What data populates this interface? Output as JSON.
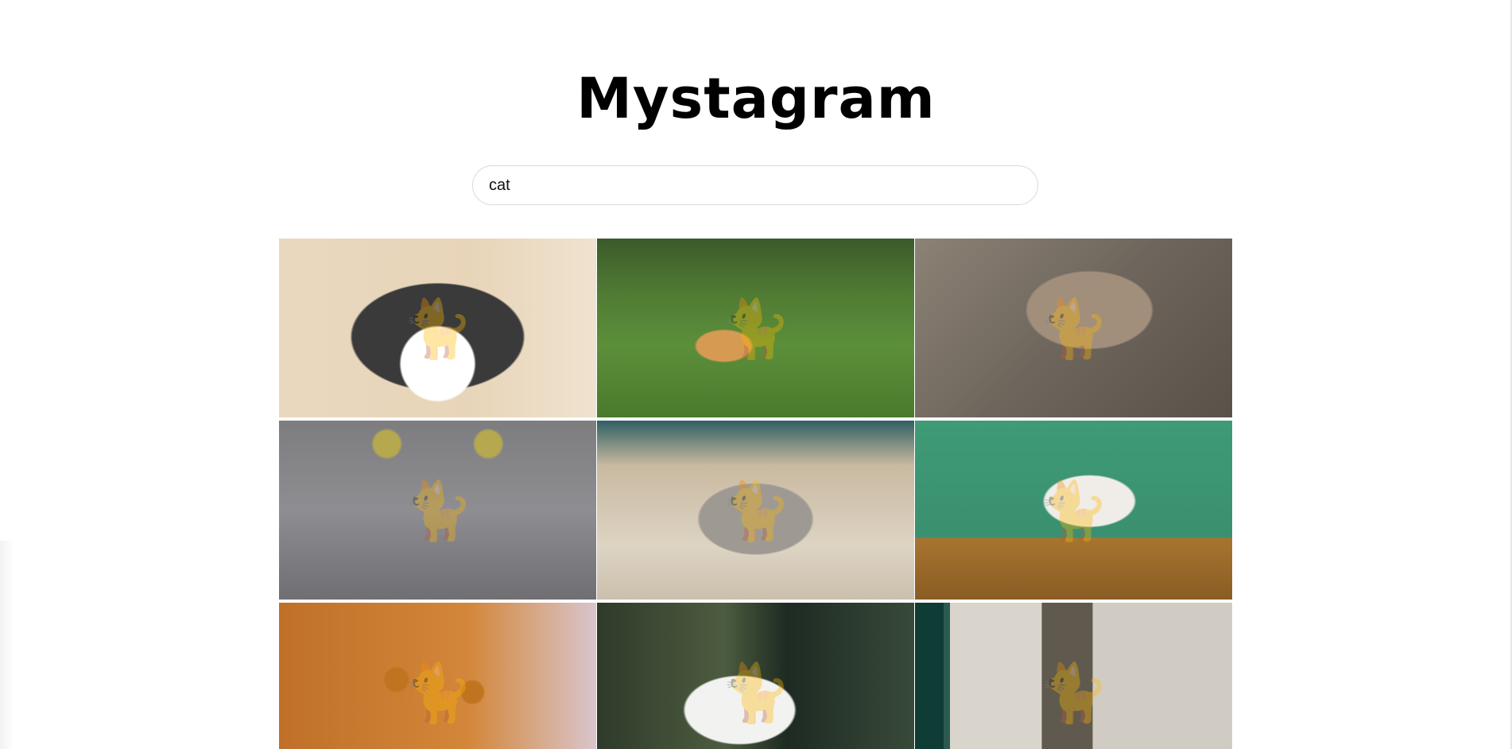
{
  "app": {
    "title": "Mystagram"
  },
  "search": {
    "value": "cat"
  },
  "gallery": {
    "items": [
      {
        "label": "",
        "icon": "cat-photo-icon",
        "colors": [
          "#e9d8bf",
          "#3a3a3a"
        ]
      },
      {
        "label": "",
        "icon": "cat-photo-icon",
        "colors": [
          "#4f7a33",
          "#d69a52"
        ]
      },
      {
        "label": "",
        "icon": "cat-photo-icon",
        "colors": [
          "#8c8276",
          "#a18f7c"
        ]
      },
      {
        "label": "",
        "icon": "cat-photo-icon",
        "colors": [
          "#8e8e92",
          "#b6a84f"
        ]
      },
      {
        "label": "",
        "icon": "cat-photo-icon",
        "colors": [
          "#ddd4c3",
          "#9e9a93"
        ]
      },
      {
        "label": "",
        "icon": "cat-photo-icon",
        "colors": [
          "#3f9a76",
          "#f0ede8"
        ]
      },
      {
        "label": "",
        "icon": "cat-photo-icon",
        "colors": [
          "#c07028",
          "#d9c5cc"
        ]
      },
      {
        "label": "",
        "icon": "cat-photo-icon",
        "colors": [
          "#2f3a2a",
          "#f2f2f0"
        ]
      },
      {
        "label": "",
        "icon": "cat-photo-icon",
        "colors": [
          "#0f3c34",
          "#d9d4cc"
        ]
      }
    ]
  }
}
